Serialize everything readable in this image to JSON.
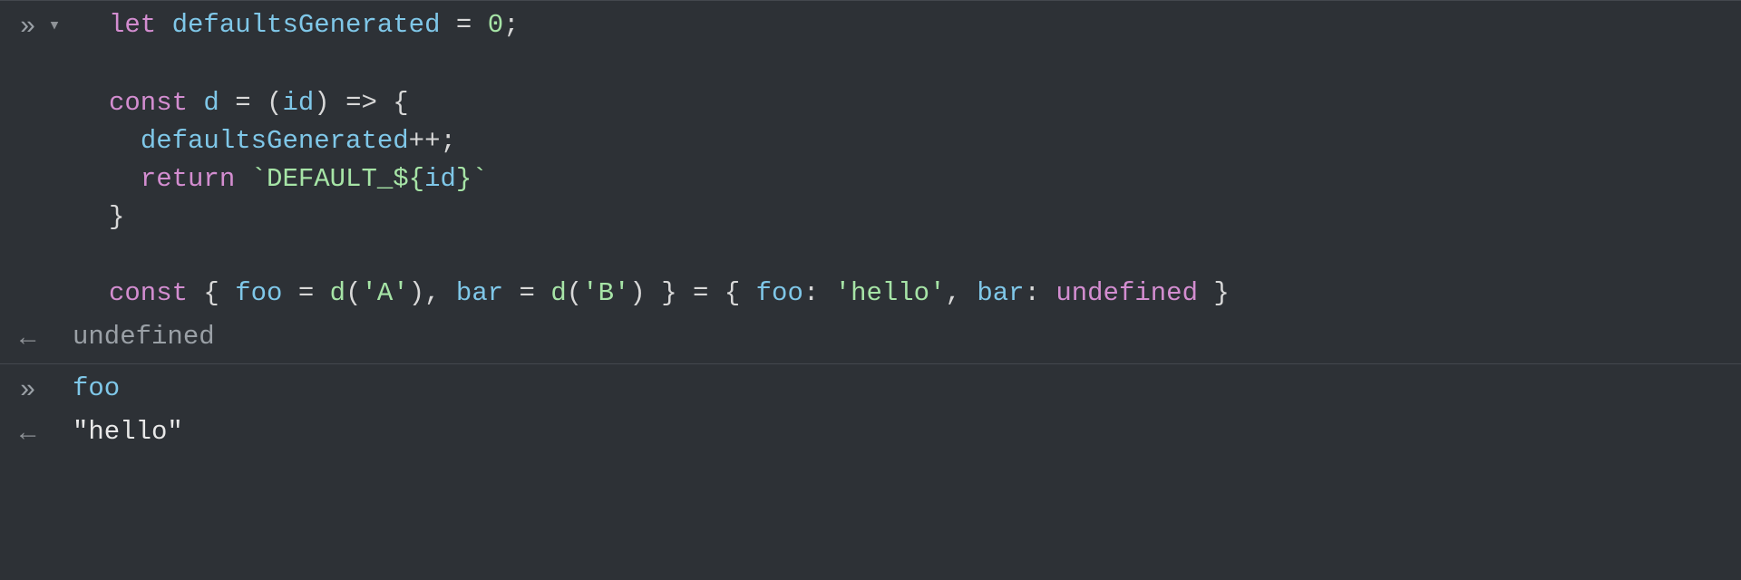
{
  "entries": [
    {
      "type": "input",
      "prompt": "»",
      "toggle": "▾",
      "code": {
        "line1": {
          "kw_let": "let",
          "sp1": " ",
          "id1": "defaultsGenerated",
          "sp2": " ",
          "op_eq": "=",
          "sp3": " ",
          "num0": "0",
          "semi": ";"
        },
        "line2": "",
        "line3": {
          "kw_const": "const",
          "sp1": " ",
          "id_d": "d",
          "sp2": " ",
          "op_eq": "=",
          "sp3": " ",
          "lp": "(",
          "id_id": "id",
          "rp": ")",
          "sp4": " ",
          "arrow": "=>",
          "sp5": " ",
          "lb": "{"
        },
        "line4": {
          "indent": "  ",
          "id1": "defaultsGenerated",
          "inc": "++",
          "semi": ";"
        },
        "line5": {
          "indent": "  ",
          "kw_return": "return",
          "sp1": " ",
          "bt1": "`",
          "lit": "DEFAULT_",
          "dl": "${",
          "id_id": "id",
          "dr": "}",
          "bt2": "`"
        },
        "line6": {
          "rb": "}"
        },
        "line7": "",
        "line8": {
          "kw_const": "const",
          "sp1": " ",
          "lb": "{",
          "sp2": " ",
          "foo": "foo",
          "sp3": " ",
          "eq1": "=",
          "sp4": " ",
          "d1": "d",
          "lp1": "(",
          "a": "'A'",
          "rp1": ")",
          "c1": ",",
          "sp5": " ",
          "bar": "bar",
          "sp6": " ",
          "eq2": "=",
          "sp7": " ",
          "d2": "d",
          "lp2": "(",
          "b": "'B'",
          "rp2": ")",
          "sp8": " ",
          "rb": "}",
          "sp9": " ",
          "eq3": "=",
          "sp10": " ",
          "lb2": "{",
          "sp11": " ",
          "foo2": "foo",
          "col1": ":",
          "sp12": " ",
          "hello": "'hello'",
          "c2": ",",
          "sp13": " ",
          "bar2": "bar",
          "col2": ":",
          "sp14": " ",
          "undef": "undefined",
          "sp15": " ",
          "rb2": "}"
        }
      }
    },
    {
      "type": "output",
      "prompt": "←",
      "text": "undefined"
    },
    {
      "type": "input",
      "prompt": "»",
      "code_simple": "foo"
    },
    {
      "type": "output",
      "prompt": "←",
      "text": "\"hello\""
    }
  ]
}
